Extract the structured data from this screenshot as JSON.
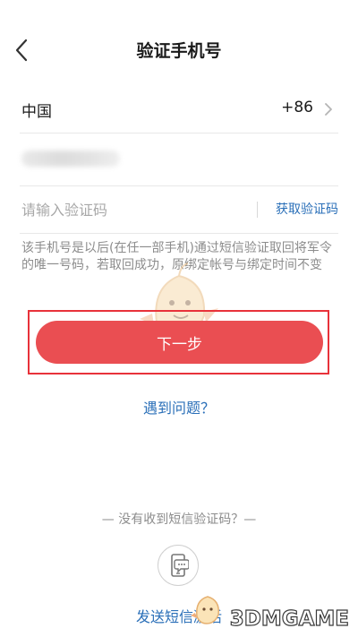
{
  "header": {
    "title": "验证手机号",
    "back_icon": "back-arrow-icon"
  },
  "country_row": {
    "name": "中国",
    "code": "+86",
    "chevron_icon": "chevron-right-icon"
  },
  "phone_row": {
    "value": ""
  },
  "code_row": {
    "placeholder": "请输入验证码",
    "get_code_label": "获取验证码"
  },
  "notice": "该手机号是以后(在任一部手机)通过短信验证取回将军令的唯一号码，若取回成功，原绑定帐号与绑定时间不变",
  "next_button": {
    "label": "下一步"
  },
  "problem_link": "遇到问题？",
  "no_sms_text": "— 没有收到短信验证码？—",
  "send_sms": {
    "label": "发送短信激活",
    "icon": "sms-phone-icon"
  },
  "watermark": "3DMGAME",
  "colors": {
    "accent_red": "#ea4e52",
    "link_blue": "#2a6fb8",
    "highlight_frame": "#e8323a"
  }
}
